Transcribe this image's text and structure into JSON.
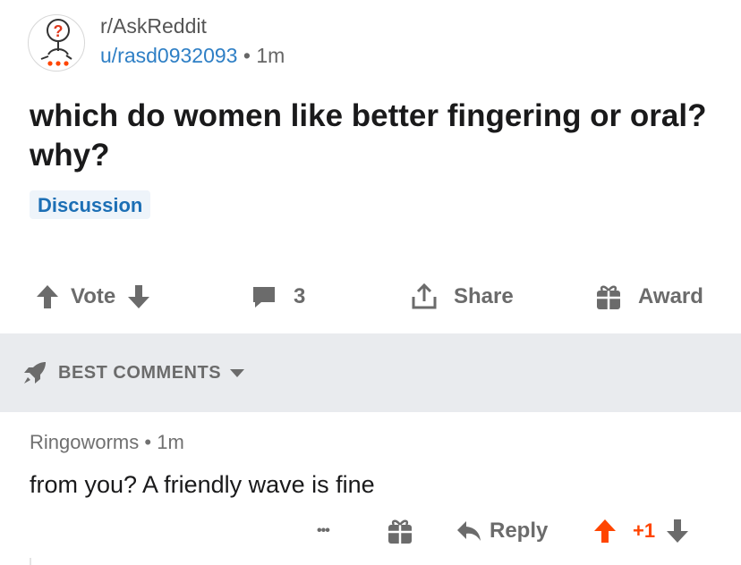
{
  "post": {
    "subreddit": "r/AskReddit",
    "author": "u/rasd0932093",
    "separator": "•",
    "time": "1m",
    "title": "which do women like better fingering or oral? why?",
    "flair": "Discussion"
  },
  "actions": {
    "vote_label": "Vote",
    "comment_count": "3",
    "share_label": "Share",
    "award_label": "Award"
  },
  "sort": {
    "label": "BEST COMMENTS"
  },
  "comment": {
    "author": "Ringoworms",
    "separator": "•",
    "time": "1m",
    "body": "from you?  A friendly wave is fine",
    "more_label": "•••",
    "reply_label": "Reply",
    "score": "+1"
  },
  "colors": {
    "upvoted": "#ff4500",
    "link": "#2e7fc5",
    "flair_text": "#1c6fb5",
    "band": "#e9ebee"
  },
  "icons": {
    "subreddit_avatar": "askreddit-avatar-icon",
    "upvote": "arrow-up-icon",
    "downvote": "arrow-down-icon",
    "comments": "speech-bubble-icon",
    "share": "share-icon",
    "award": "gift-icon",
    "sort": "rocket-icon",
    "sort_caret": "caret-down-icon",
    "reply": "reply-arrow-icon"
  }
}
